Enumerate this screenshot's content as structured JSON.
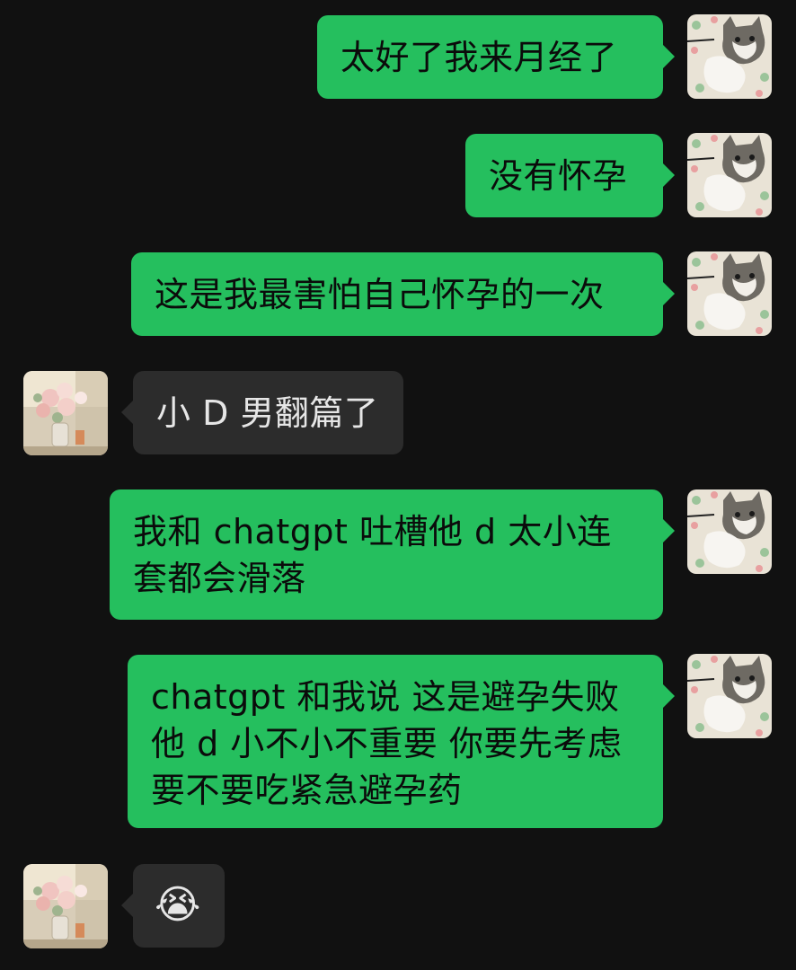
{
  "messages": [
    {
      "sender": "me",
      "text": "太好了我来月经了"
    },
    {
      "sender": "me",
      "text": "没有怀孕"
    },
    {
      "sender": "me",
      "text": "这是我最害怕自己怀孕的一次"
    },
    {
      "sender": "other",
      "text": "小 D 男翻篇了"
    },
    {
      "sender": "me",
      "text": "我和 chatgpt 吐槽他 d 太小连套都会滑落"
    },
    {
      "sender": "me",
      "text": "chatgpt 和我说 这是避孕失败 他 d 小不小不重要 你要先考虑要不要吃紧急避孕药"
    },
    {
      "sender": "other",
      "text": "😭"
    }
  ],
  "colors": {
    "background": "#111111",
    "self_bubble": "#25BF5E",
    "other_bubble": "#2c2c2c"
  },
  "icons": {
    "self_avatar": "cat-avatar-icon",
    "other_avatar": "flower-bouquet-avatar-icon"
  }
}
